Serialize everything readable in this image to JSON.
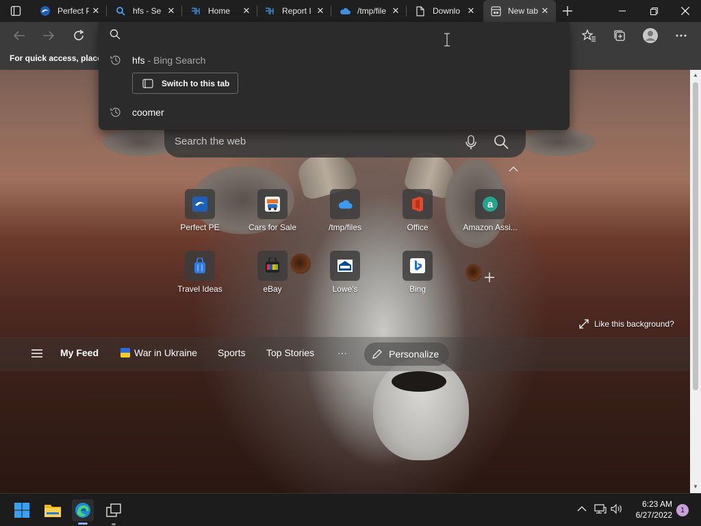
{
  "tabs": [
    {
      "title": "Perfect P",
      "icon": "perfect-pe-icon",
      "close": "✕"
    },
    {
      "title": "hfs - Se",
      "icon": "search-favicon",
      "close": "✕"
    },
    {
      "title": "Home",
      "icon": "hfs-icon",
      "close": "✕"
    },
    {
      "title": "Report I",
      "icon": "hfs-icon",
      "close": "✕"
    },
    {
      "title": "/tmp/file",
      "icon": "onedrive-icon",
      "close": "✕"
    },
    {
      "title": "Downlo",
      "icon": "page-icon",
      "close": "✕"
    },
    {
      "title": "New tab",
      "icon": "new-tab-icon",
      "close": "✕",
      "active": true
    }
  ],
  "favorites_bar": {
    "text": "For quick access, place y"
  },
  "omnibox": {
    "input_value": "",
    "suggestions": [
      {
        "text": "hfs",
        "sub": "- Bing Search"
      },
      {
        "text": "coomer",
        "sub": ""
      }
    ],
    "switch_tab_label": "Switch to this tab"
  },
  "web_search": {
    "placeholder": "Search the web"
  },
  "tiles": [
    {
      "label": "Perfect PE",
      "icon": "perfect-pe-icon"
    },
    {
      "label": "Cars for Sale",
      "icon": "cars-icon"
    },
    {
      "label": "/tmp/files",
      "icon": "onedrive-icon"
    },
    {
      "label": "Office",
      "icon": "office-icon"
    },
    {
      "label": "Amazon Assi...",
      "icon": "amazon-icon"
    },
    {
      "label": "Travel Ideas",
      "icon": "travel-bag-icon"
    },
    {
      "label": "eBay",
      "icon": "ebay-icon"
    },
    {
      "label": "Lowe's",
      "icon": "lowes-icon"
    },
    {
      "label": "Bing",
      "icon": "bing-icon"
    }
  ],
  "like_background": "Like this background?",
  "feed": {
    "items": [
      "My Feed",
      "War in Ukraine",
      "Sports",
      "Top Stories"
    ],
    "more": "···",
    "personalize": "Personalize"
  },
  "taskbar": {
    "time": "6:23 AM",
    "date": "6/27/2022",
    "notification_count": "1"
  },
  "colors": {
    "tabstrip_bg": "#1f1f1f",
    "toolbar_bg": "#3b3b3b",
    "omnibox_bg": "#2b2b2b",
    "taskbar_bg": "#1c1c1c"
  }
}
